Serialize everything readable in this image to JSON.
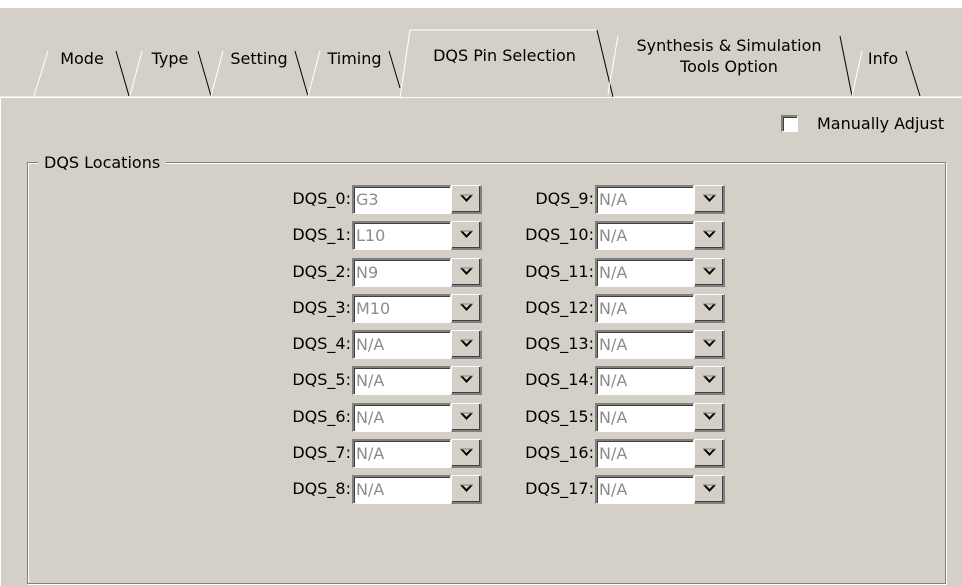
{
  "tabs": [
    {
      "id": "mode",
      "label": "Mode"
    },
    {
      "id": "type",
      "label": "Type"
    },
    {
      "id": "setting",
      "label": "Setting"
    },
    {
      "id": "timing",
      "label": "Timing"
    },
    {
      "id": "dqs-pin-selection",
      "label": "DQS Pin Selection",
      "active": true
    },
    {
      "id": "synthesis",
      "label_line1": "Synthesis & Simulation",
      "label_line2": "Tools Option"
    },
    {
      "id": "info",
      "label": "Info"
    }
  ],
  "manual_adjust": {
    "label": "Manually Adjust",
    "checked": false
  },
  "dqs_locations": {
    "title": "DQS Locations",
    "left": [
      {
        "label": "DQS_0:",
        "value": "G3"
      },
      {
        "label": "DQS_1:",
        "value": "L10"
      },
      {
        "label": "DQS_2:",
        "value": "N9"
      },
      {
        "label": "DQS_3:",
        "value": "M10"
      },
      {
        "label": "DQS_4:",
        "value": "N/A"
      },
      {
        "label": "DQS_5:",
        "value": "N/A"
      },
      {
        "label": "DQS_6:",
        "value": "N/A"
      },
      {
        "label": "DQS_7:",
        "value": "N/A"
      },
      {
        "label": "DQS_8:",
        "value": "N/A"
      }
    ],
    "right": [
      {
        "label": "DQS_9:",
        "value": "N/A"
      },
      {
        "label": "DQS_10:",
        "value": "N/A"
      },
      {
        "label": "DQS_11:",
        "value": "N/A"
      },
      {
        "label": "DQS_12:",
        "value": "N/A"
      },
      {
        "label": "DQS_13:",
        "value": "N/A"
      },
      {
        "label": "DQS_14:",
        "value": "N/A"
      },
      {
        "label": "DQS_15:",
        "value": "N/A"
      },
      {
        "label": "DQS_16:",
        "value": "N/A"
      },
      {
        "label": "DQS_17:",
        "value": "N/A"
      }
    ]
  },
  "icons": {
    "dropdown": "chevron-down-icon"
  },
  "colors": {
    "face": "#d4d0c8",
    "shadow": "#808080",
    "highlight": "#ffffff",
    "disabled_text": "#8c8c8c"
  }
}
